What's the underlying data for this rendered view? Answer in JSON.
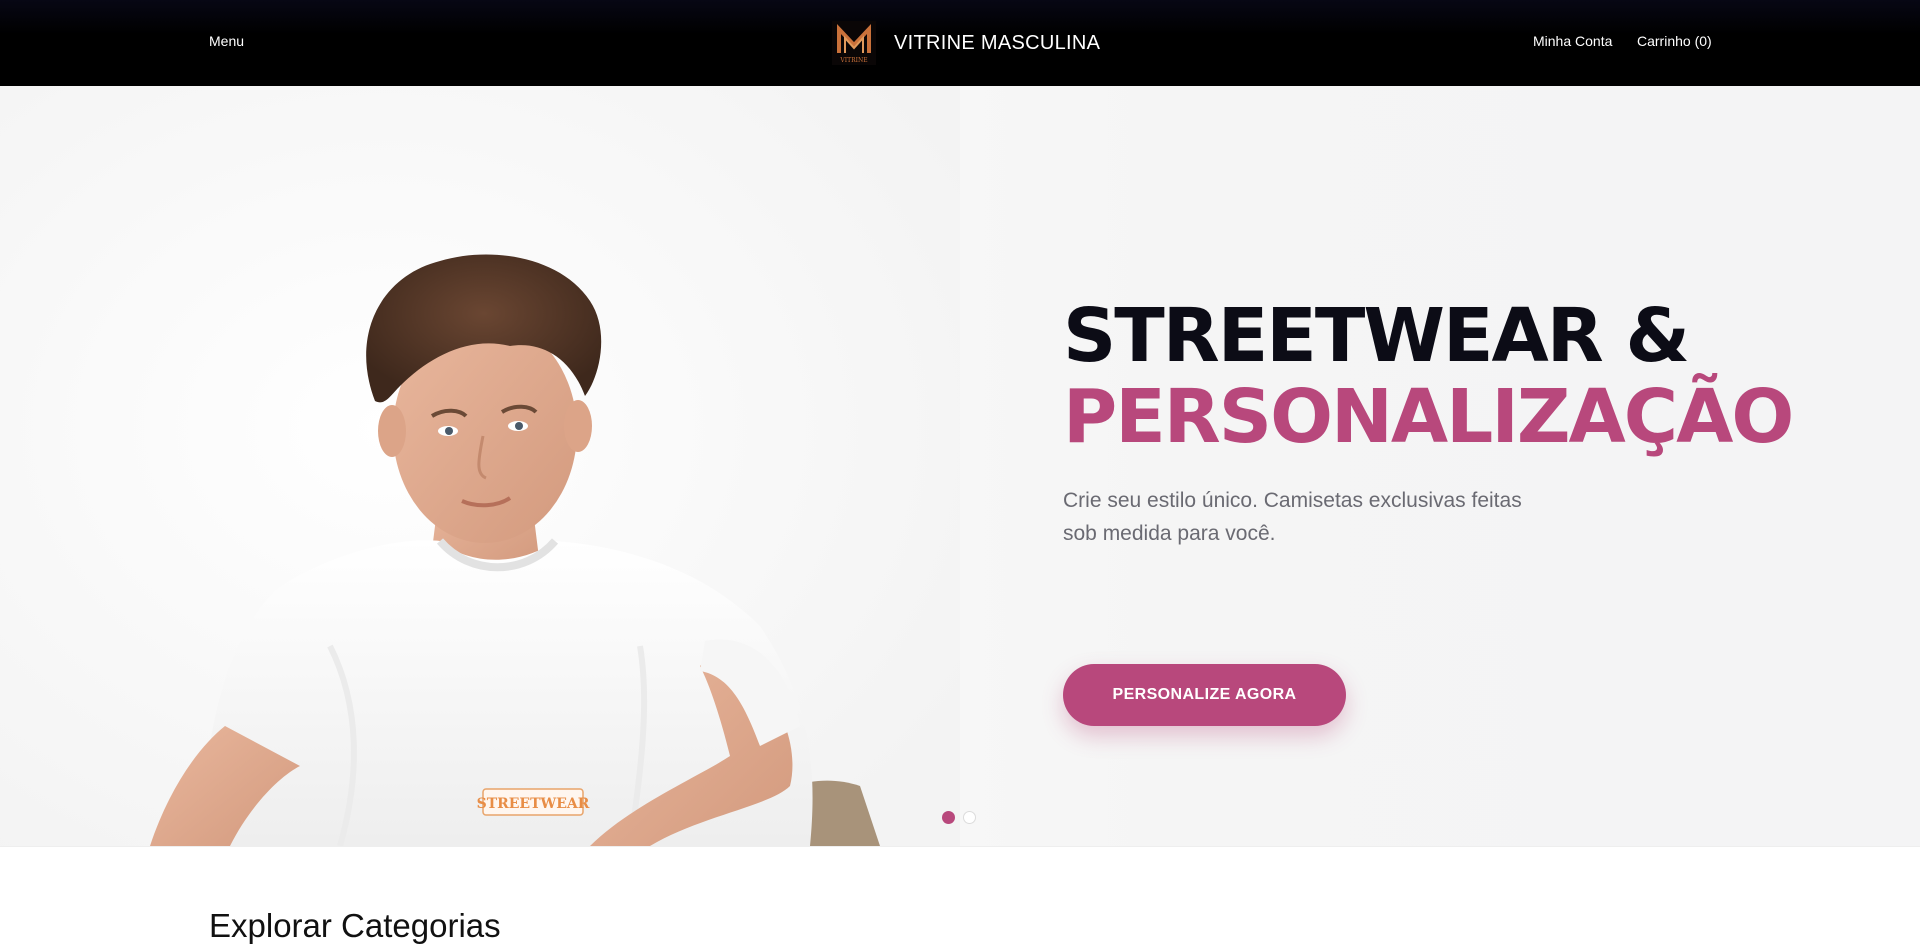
{
  "header": {
    "menu_label": "Menu",
    "brand_name": "VITRINE MASCULINA",
    "brand_logo_text": "VITRINE",
    "account_label": "Minha Conta",
    "cart_label": "Carrinho (0)",
    "background_color": "#000000"
  },
  "hero": {
    "title_line1": "STREETWEAR &",
    "title_line2": "PERSONALIZAÇÃO",
    "subtitle": "Crie seu estilo único. Camisetas exclusivas feitas sob medida para você.",
    "cta_label": "PERSONALIZE AGORA",
    "shirt_print_text": "STREETWEAR",
    "slides": {
      "count": 2,
      "active_index": 0
    },
    "accent_color": "#b8487c"
  },
  "categories": {
    "title": "Explorar Categorias"
  }
}
